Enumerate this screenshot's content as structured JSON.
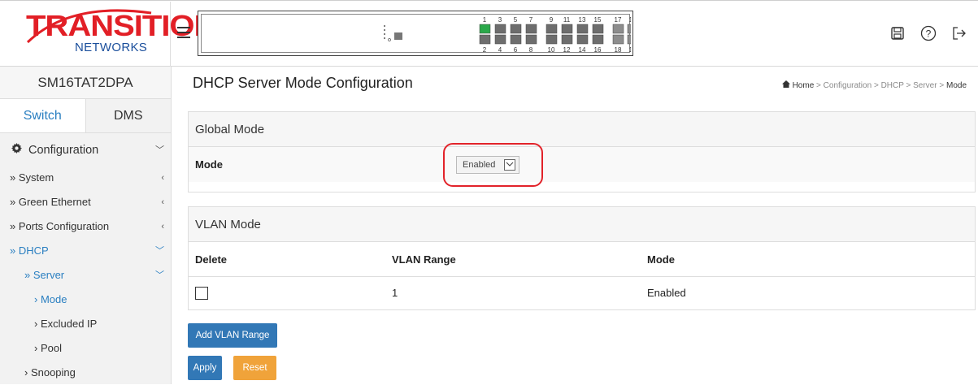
{
  "header": {
    "logo_main": "TRANSITION",
    "logo_sub": "NETWORKS",
    "port_labels_top": [
      "1",
      "3",
      "5",
      "7",
      "9",
      "11",
      "13",
      "15",
      "17",
      "17"
    ],
    "port_labels_bottom": [
      "2",
      "4",
      "6",
      "8",
      "10",
      "12",
      "14",
      "16",
      "18",
      "18"
    ],
    "icons": [
      "save-icon",
      "help-icon",
      "logout-icon"
    ]
  },
  "sidebar": {
    "device_name": "SM16TAT2DPA",
    "tabs": [
      "Switch",
      "DMS"
    ],
    "items": [
      {
        "label": "Configuration",
        "arrow": "﹀"
      },
      {
        "label": "» System",
        "arrow": "‹"
      },
      {
        "label": "» Green Ethernet",
        "arrow": "‹"
      },
      {
        "label": "» Ports Configuration",
        "arrow": "‹"
      },
      {
        "label": "» DHCP",
        "arrow": "﹀"
      },
      {
        "label": "» Server",
        "arrow": "﹀"
      },
      {
        "label": "› Mode",
        "arrow": ""
      },
      {
        "label": "› Excluded IP",
        "arrow": ""
      },
      {
        "label": "› Pool",
        "arrow": ""
      },
      {
        "label": "› Snooping",
        "arrow": ""
      }
    ]
  },
  "main": {
    "title": "DHCP Server Mode Configuration",
    "breadcrumb": {
      "home": "Home",
      "path": [
        "Configuration",
        "DHCP",
        "Server"
      ],
      "current": "Mode",
      "sep": ">"
    },
    "global_mode": {
      "heading": "Global Mode",
      "label": "Mode",
      "value": "Enabled"
    },
    "vlan_mode": {
      "heading": "VLAN Mode",
      "columns": [
        "Delete",
        "VLAN Range",
        "Mode"
      ],
      "rows": [
        {
          "range": "1",
          "mode": "Enabled"
        }
      ]
    },
    "buttons": {
      "add": "Add VLAN Range",
      "apply": "Apply",
      "reset": "Reset"
    }
  }
}
